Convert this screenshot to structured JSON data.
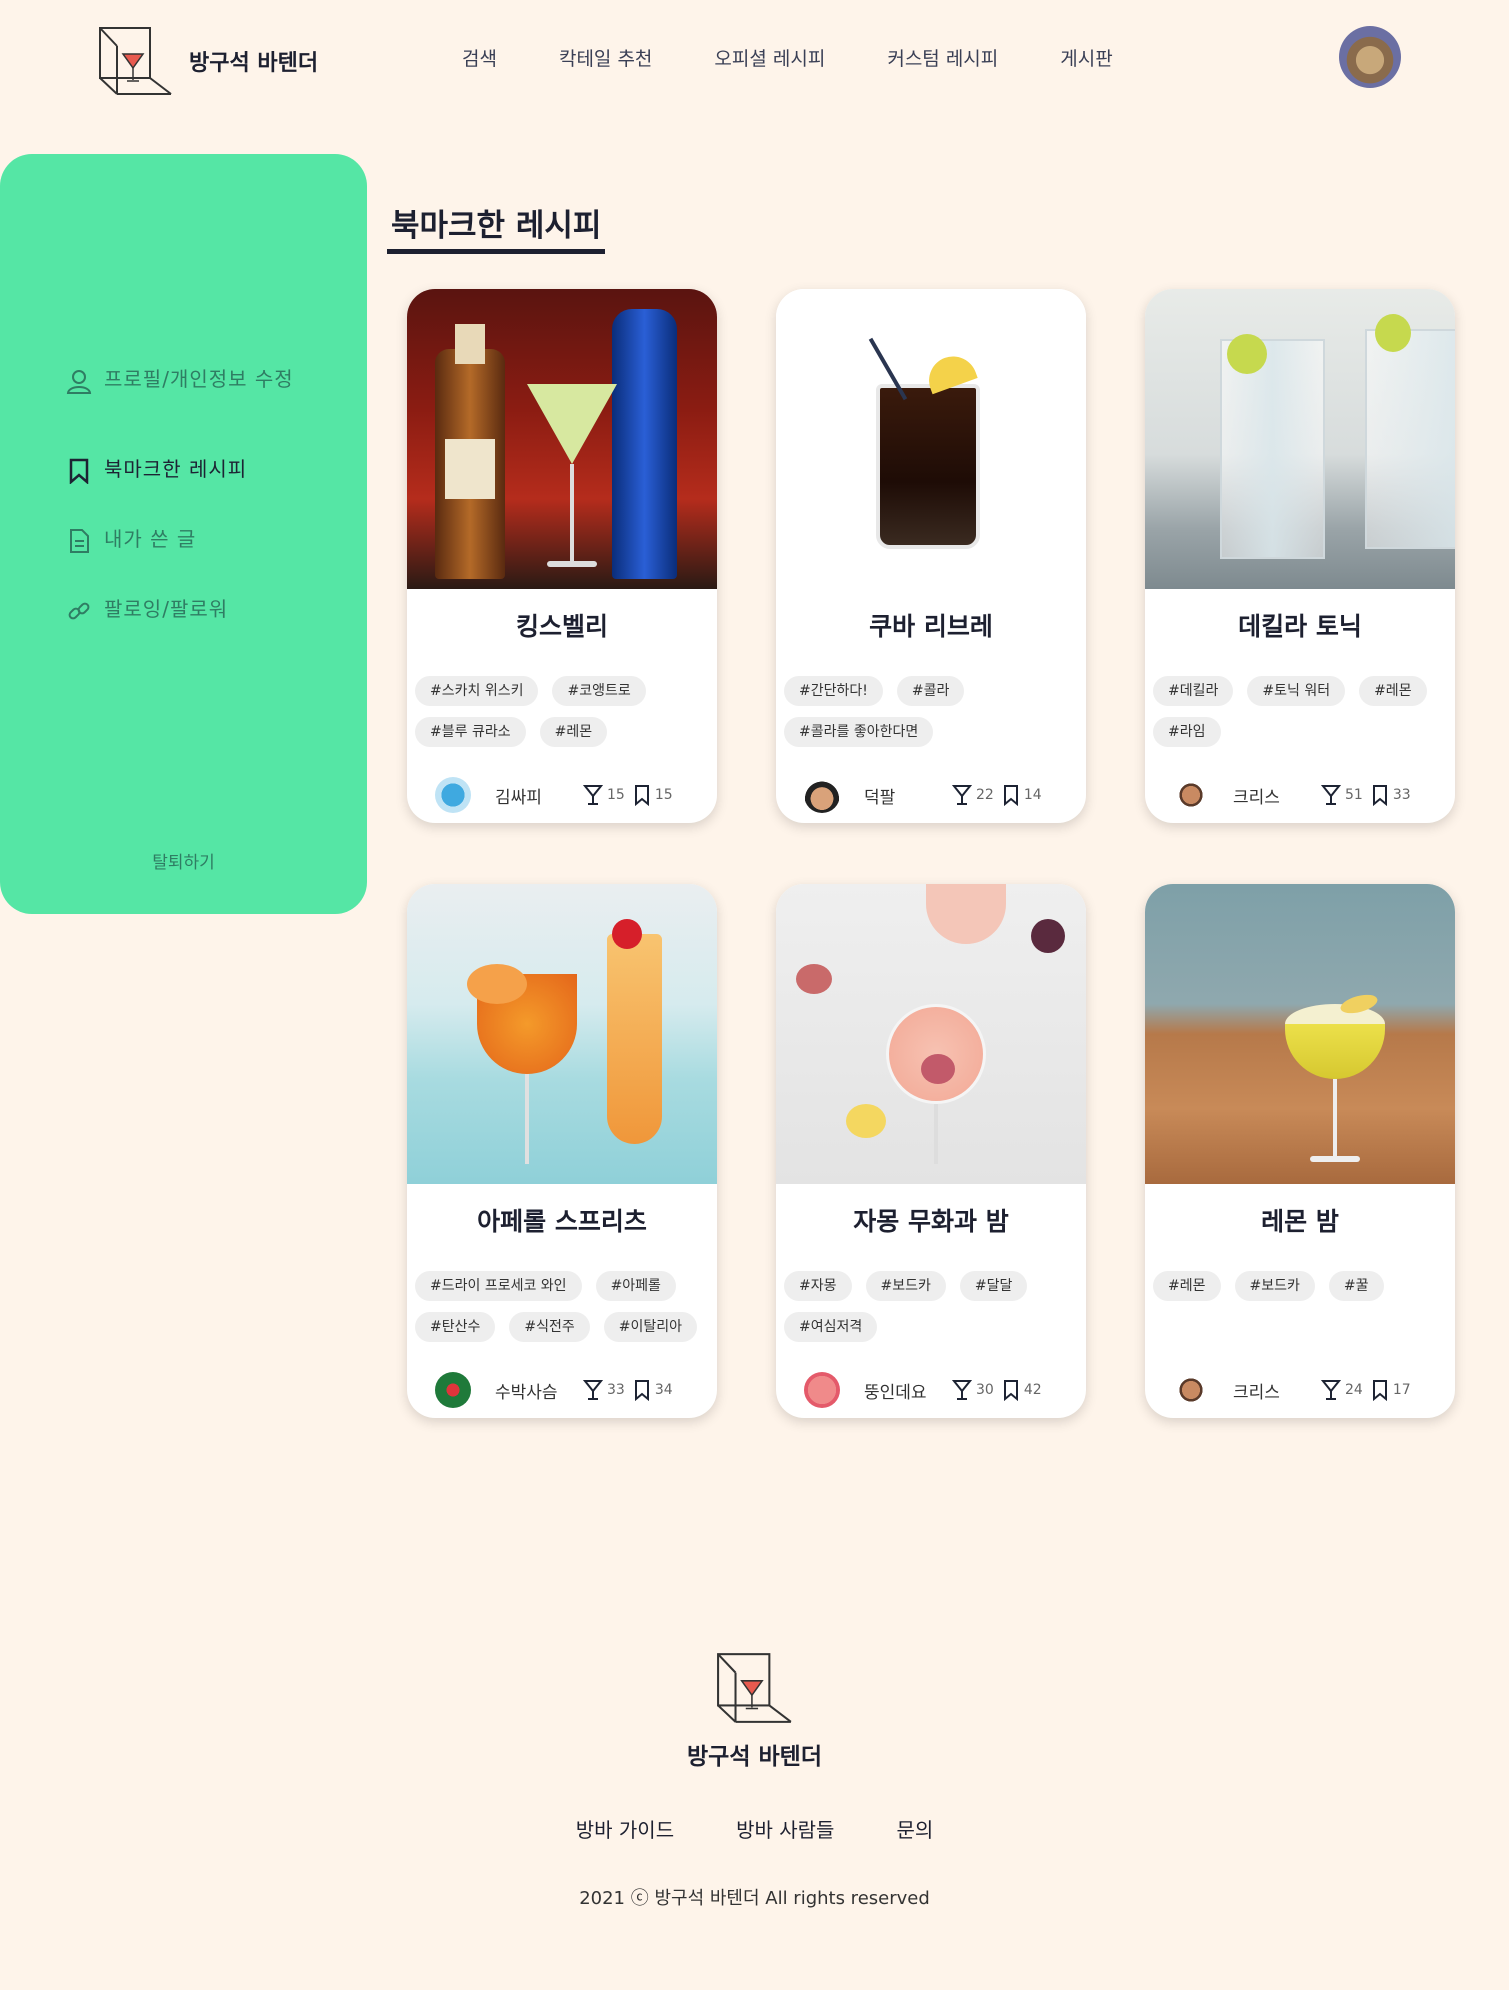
{
  "brand": {
    "name": "방구석 바텐더"
  },
  "nav": {
    "items": [
      "검색",
      "칵테일 추천",
      "오피셜 레시피",
      "커스텀 레시피",
      "게시판"
    ]
  },
  "sidebar": {
    "items": [
      {
        "label": "프로필/개인정보 수정",
        "icon": "user-icon"
      },
      {
        "label": "북마크한 레시피",
        "icon": "bookmark-icon"
      },
      {
        "label": "내가 쓴 글",
        "icon": "document-icon"
      },
      {
        "label": "팔로잉/팔로워",
        "icon": "link-icon"
      }
    ],
    "withdraw": "탈퇴하기"
  },
  "main": {
    "title": "북마크한 레시피",
    "cards": [
      {
        "title": "킹스벨리",
        "tags": [
          "#스카치 위스키",
          "#코앵트로",
          "#블루 큐라소",
          "#레몬"
        ],
        "user": "김싸피",
        "likes": "15",
        "bookmarks": "15"
      },
      {
        "title": "쿠바 리브레",
        "tags": [
          "#간단하다!",
          "#콜라",
          "#콜라를 좋아한다면"
        ],
        "user": "덕팔",
        "likes": "22",
        "bookmarks": "14"
      },
      {
        "title": "데킬라 토닉",
        "tags": [
          "#데킬라",
          "#토닉 워터",
          "#레몬",
          "#라임"
        ],
        "user": "크리스",
        "likes": "51",
        "bookmarks": "33"
      },
      {
        "title": "아페롤 스프리츠",
        "tags": [
          "#드라이 프로세코 와인",
          "#아페롤",
          "#탄산수",
          "#식전주",
          "#이탈리아"
        ],
        "user": "수박사슴",
        "likes": "33",
        "bookmarks": "34"
      },
      {
        "title": "자몽 무화과 밤",
        "tags": [
          "#자몽",
          "#보드카",
          "#달달",
          "#여심저격"
        ],
        "user": "뚱인데요",
        "likes": "30",
        "bookmarks": "42"
      },
      {
        "title": "레몬 밤",
        "tags": [
          "#레몬",
          "#보드카",
          "#꿀"
        ],
        "user": "크리스",
        "likes": "24",
        "bookmarks": "17"
      }
    ]
  },
  "footer": {
    "name": "방구석 바텐더",
    "links": [
      "방바 가이드",
      "방바 사람들",
      "문의"
    ],
    "copyright": "2021 ⓒ 방구석 바텐더 All rights reserved"
  },
  "colors": {
    "background": "#FEF4EA",
    "sidebar": "#55E6A5",
    "text": "#1d2030"
  }
}
